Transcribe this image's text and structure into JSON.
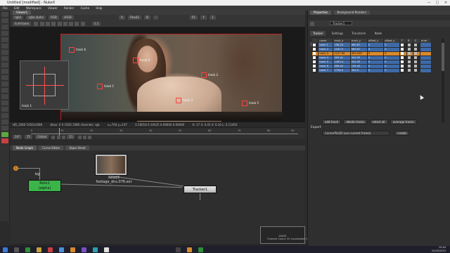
{
  "window": {
    "title": "Untitled [modified] - NukeX",
    "min": "—",
    "max": "□",
    "close": "✕"
  },
  "menu": [
    "File",
    "Edit",
    "Workspace",
    "Viewer",
    "Render",
    "Cache",
    "Help"
  ],
  "viewer": {
    "tabs": [
      "Viewer1"
    ],
    "ctrl1": {
      "layer": "rgba",
      "channel": "rgba.alpha",
      "colorspace": "RGB",
      "gain_label": "sRGB",
      "read_a": "A",
      "read_name": "Read3",
      "read_b": "B",
      "none": "-",
      "fstop_label": "f/1",
      "frame_label": "1",
      "proxy": "1:1",
      "gamma_label": "Y",
      "gamma": "1"
    },
    "ctrl2": {
      "format": "Full-frame",
      "scale": "1.1"
    },
    "info_left": "HD_1080 1920x1080",
    "info_bbox": "bbox: 0 0 1920 1080 channels: rgb",
    "info_coords": "x=704 y=147",
    "info_values": "0.16018 0.10425 0.09040 0.00000",
    "info_hsv": "H: 17 S: 0.45 V: 0.16 L: 0.11450",
    "track_labels": [
      "track 1",
      "track 2",
      "track 3",
      "track 4",
      "track 5",
      "track 6"
    ]
  },
  "timeline": {
    "ticks": [
      "0",
      "10",
      "20",
      "30",
      "40",
      "50",
      "60",
      "70",
      "80",
      "90"
    ],
    "fps": "24*",
    "tf": "TF",
    "mode": "Global",
    "frame": "21"
  },
  "nodegraph": {
    "tabs": [
      "Node Graph",
      "Curve Editor",
      "Dope Sheet"
    ],
    "dot_label": "1",
    "bg_label": "bg",
    "roto_label": "Roto1",
    "roto_sub": "(alpha)",
    "read_title": "Read3",
    "read_file": "footage_dns.076.exr",
    "tracker_label": "Tracker1",
    "minimap_label": "zoom"
  },
  "status": "Channel Count: 20 Localization Mode: On Memory: 3.7 GB (17.8%) CPU: 12.5% Disk: 0.0 MB/s Network: 0.0 MB/s",
  "properties": {
    "tabs": [
      "Properties",
      "Background Renders"
    ],
    "node_name": "Tracker1",
    "subtabs": [
      "Tracker",
      "Settings",
      "Transform",
      "Node"
    ],
    "columns": [
      "",
      "name",
      "track_x",
      "track_y",
      "offset_x",
      "offset_y",
      "T",
      "R",
      "S",
      "error"
    ],
    "rows": [
      {
        "name": "track 1",
        "x": "196.25",
        "y": "960.67",
        "ox": "0",
        "oy": "0",
        "error": ""
      },
      {
        "name": "track 2",
        "x": "1441.5",
        "y": "960.67",
        "ox": "0",
        "oy": "0",
        "error": ""
      },
      {
        "name": "track 3",
        "x": "1127.96",
        "y": "999.436",
        "ox": "0",
        "oy": "0",
        "error": "",
        "selected": true
      },
      {
        "name": "track 4",
        "x": "305.41",
        "y": "542.95",
        "ox": "0",
        "oy": "0",
        "error": ""
      },
      {
        "name": "track 5",
        "x": "1495.4",
        "y": "542.95",
        "ox": "0",
        "oy": "0",
        "error": ""
      },
      {
        "name": "track 6",
        "x": "956.42",
        "y": "155.45",
        "ox": "0",
        "oy": "0",
        "error": ""
      },
      {
        "name": "track 7",
        "x": "1726.5",
        "y": "354.3",
        "ox": "0",
        "oy": "0",
        "error": ""
      }
    ],
    "buttons": [
      "add track",
      "delete tracks",
      "select all",
      "average tracks"
    ],
    "export_label": "Export",
    "export_select": "CornerPin2D (use current frame)",
    "create_button": "create"
  },
  "taskbar": {
    "time": "15:40",
    "date": "22/05/2023"
  },
  "colors": {
    "accent": "#d8892c",
    "selection_blue": "#3e6aa8",
    "roto_green": "#3bb54a",
    "tracker_red": "#ff4040"
  }
}
